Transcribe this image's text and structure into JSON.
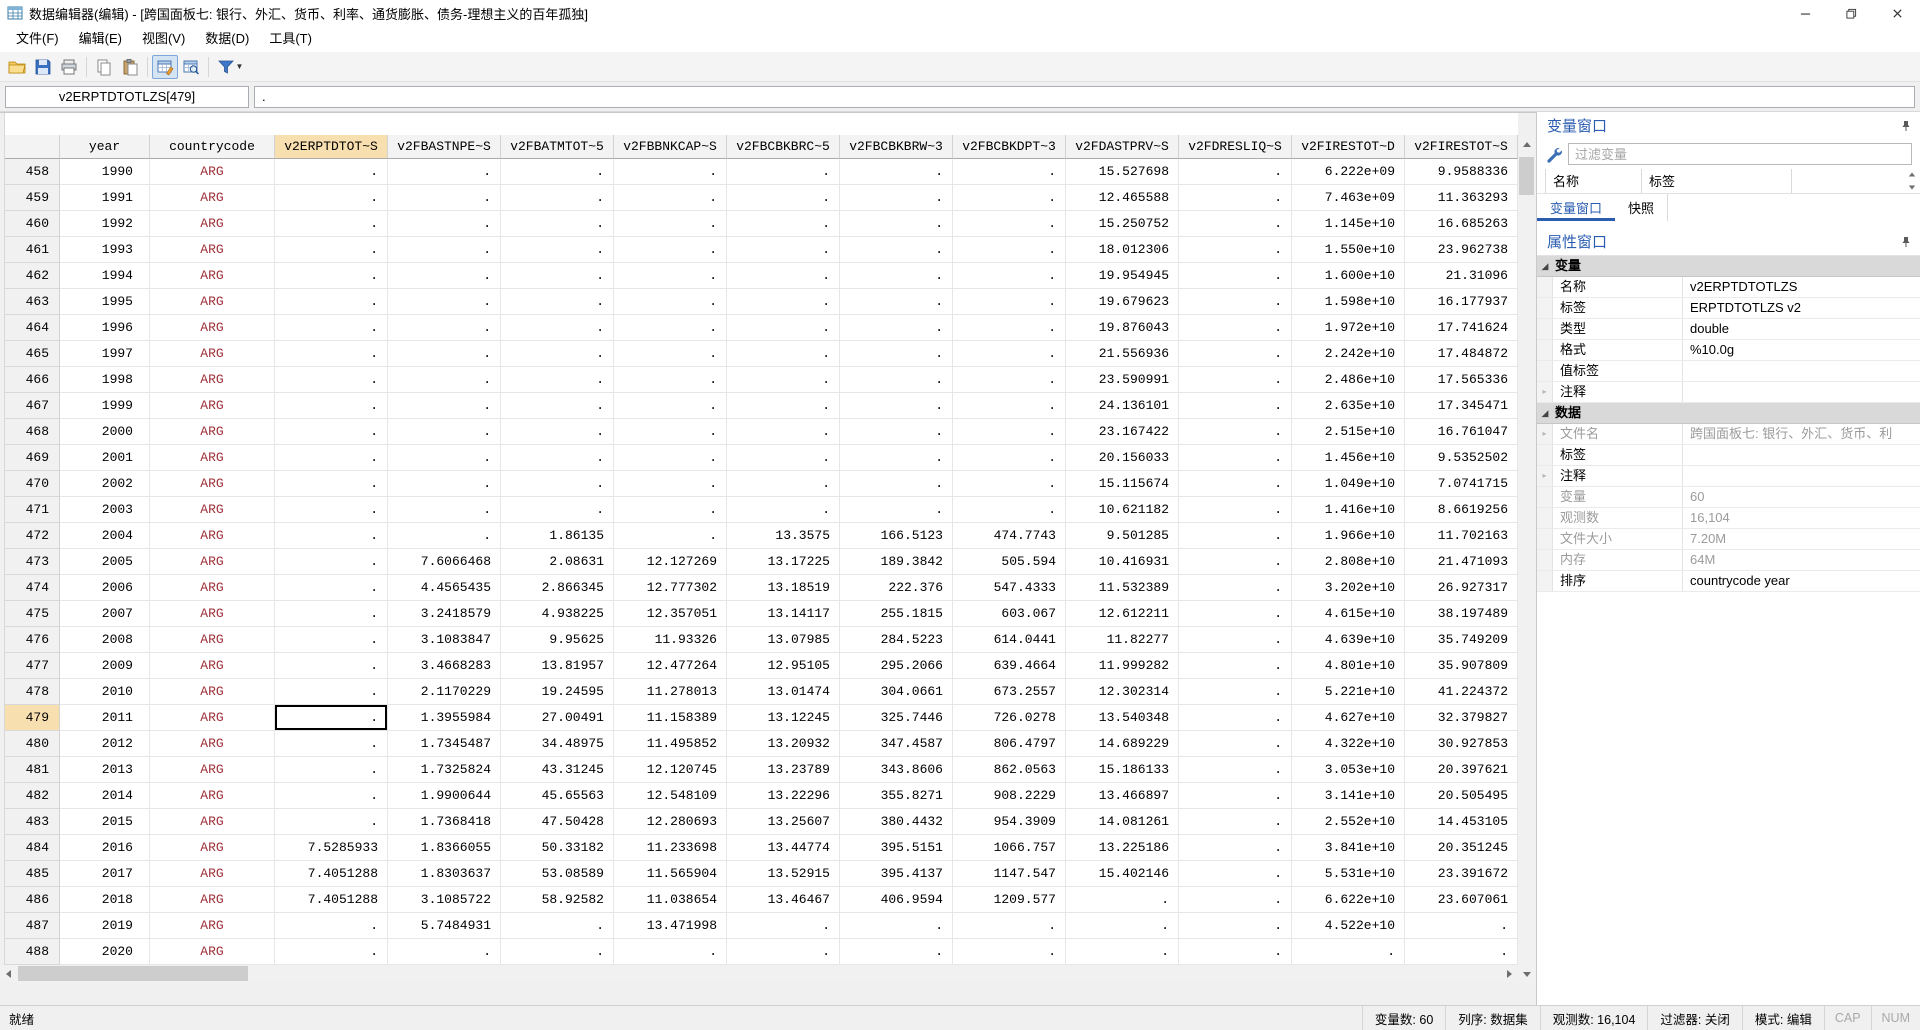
{
  "window": {
    "title": "数据编辑器(编辑) - [跨国面板七: 银行、外汇、货币、利率、通货膨胀、债务-理想主义的百年孤独]"
  },
  "menu": [
    "文件(F)",
    "编辑(E)",
    "视图(V)",
    "数据(D)",
    "工具(T)"
  ],
  "toolbar": {
    "icons": [
      "open-icon",
      "save-icon",
      "print-icon",
      "copy-icon",
      "paste-icon",
      "data-editor-icon",
      "data-browser-icon",
      "filter-icon"
    ]
  },
  "formula_bar": {
    "cell_ref": "v2ERPTDTOTLZS[479]",
    "cell_value": "."
  },
  "table": {
    "columns": [
      "year",
      "countrycode",
      "v2ERPTDTOT~S",
      "v2FBASTNPE~S",
      "v2FBATMTOT~5",
      "v2FBBNKCAP~S",
      "v2FBCBKBRC~5",
      "v2FBCBKBRW~3",
      "v2FBCBKDPT~3",
      "v2FDASTPRV~S",
      "v2FDRESLIQ~S",
      "v2FIRESTOT~D",
      "v2FIRESTOT~S"
    ],
    "selected": {
      "row_num": "479",
      "column": "v2ERPTDTOT~S",
      "col_index": 2
    },
    "rows": [
      {
        "num": "458",
        "cells": [
          "1990",
          "ARG",
          ".",
          ".",
          ".",
          ".",
          ".",
          ".",
          ".",
          "15.527698",
          ".",
          "6.222e+09",
          "9.9588336"
        ]
      },
      {
        "num": "459",
        "cells": [
          "1991",
          "ARG",
          ".",
          ".",
          ".",
          ".",
          ".",
          ".",
          ".",
          "12.465588",
          ".",
          "7.463e+09",
          "11.363293"
        ]
      },
      {
        "num": "460",
        "cells": [
          "1992",
          "ARG",
          ".",
          ".",
          ".",
          ".",
          ".",
          ".",
          ".",
          "15.250752",
          ".",
          "1.145e+10",
          "16.685263"
        ]
      },
      {
        "num": "461",
        "cells": [
          "1993",
          "ARG",
          ".",
          ".",
          ".",
          ".",
          ".",
          ".",
          ".",
          "18.012306",
          ".",
          "1.550e+10",
          "23.962738"
        ]
      },
      {
        "num": "462",
        "cells": [
          "1994",
          "ARG",
          ".",
          ".",
          ".",
          ".",
          ".",
          ".",
          ".",
          "19.954945",
          ".",
          "1.600e+10",
          "21.31096"
        ]
      },
      {
        "num": "463",
        "cells": [
          "1995",
          "ARG",
          ".",
          ".",
          ".",
          ".",
          ".",
          ".",
          ".",
          "19.679623",
          ".",
          "1.598e+10",
          "16.177937"
        ]
      },
      {
        "num": "464",
        "cells": [
          "1996",
          "ARG",
          ".",
          ".",
          ".",
          ".",
          ".",
          ".",
          ".",
          "19.876043",
          ".",
          "1.972e+10",
          "17.741624"
        ]
      },
      {
        "num": "465",
        "cells": [
          "1997",
          "ARG",
          ".",
          ".",
          ".",
          ".",
          ".",
          ".",
          ".",
          "21.556936",
          ".",
          "2.242e+10",
          "17.484872"
        ]
      },
      {
        "num": "466",
        "cells": [
          "1998",
          "ARG",
          ".",
          ".",
          ".",
          ".",
          ".",
          ".",
          ".",
          "23.590991",
          ".",
          "2.486e+10",
          "17.565336"
        ]
      },
      {
        "num": "467",
        "cells": [
          "1999",
          "ARG",
          ".",
          ".",
          ".",
          ".",
          ".",
          ".",
          ".",
          "24.136101",
          ".",
          "2.635e+10",
          "17.345471"
        ]
      },
      {
        "num": "468",
        "cells": [
          "2000",
          "ARG",
          ".",
          ".",
          ".",
          ".",
          ".",
          ".",
          ".",
          "23.167422",
          ".",
          "2.515e+10",
          "16.761047"
        ]
      },
      {
        "num": "469",
        "cells": [
          "2001",
          "ARG",
          ".",
          ".",
          ".",
          ".",
          ".",
          ".",
          ".",
          "20.156033",
          ".",
          "1.456e+10",
          "9.5352502"
        ]
      },
      {
        "num": "470",
        "cells": [
          "2002",
          "ARG",
          ".",
          ".",
          ".",
          ".",
          ".",
          ".",
          ".",
          "15.115674",
          ".",
          "1.049e+10",
          "7.0741715"
        ]
      },
      {
        "num": "471",
        "cells": [
          "2003",
          "ARG",
          ".",
          ".",
          ".",
          ".",
          ".",
          ".",
          ".",
          "10.621182",
          ".",
          "1.416e+10",
          "8.6619256"
        ]
      },
      {
        "num": "472",
        "cells": [
          "2004",
          "ARG",
          ".",
          ".",
          "1.86135",
          ".",
          "13.3575",
          "166.5123",
          "474.7743",
          "9.501285",
          ".",
          "1.966e+10",
          "11.702163"
        ]
      },
      {
        "num": "473",
        "cells": [
          "2005",
          "ARG",
          ".",
          "7.6066468",
          "2.08631",
          "12.127269",
          "13.17225",
          "189.3842",
          "505.594",
          "10.416931",
          ".",
          "2.808e+10",
          "21.471093"
        ]
      },
      {
        "num": "474",
        "cells": [
          "2006",
          "ARG",
          ".",
          "4.4565435",
          "2.866345",
          "12.777302",
          "13.18519",
          "222.376",
          "547.4333",
          "11.532389",
          ".",
          "3.202e+10",
          "26.927317"
        ]
      },
      {
        "num": "475",
        "cells": [
          "2007",
          "ARG",
          ".",
          "3.2418579",
          "4.938225",
          "12.357051",
          "13.14117",
          "255.1815",
          "603.067",
          "12.612211",
          ".",
          "4.615e+10",
          "38.197489"
        ]
      },
      {
        "num": "476",
        "cells": [
          "2008",
          "ARG",
          ".",
          "3.1083847",
          "9.95625",
          "11.93326",
          "13.07985",
          "284.5223",
          "614.0441",
          "11.82277",
          ".",
          "4.639e+10",
          "35.749209"
        ]
      },
      {
        "num": "477",
        "cells": [
          "2009",
          "ARG",
          ".",
          "3.4668283",
          "13.81957",
          "12.477264",
          "12.95105",
          "295.2066",
          "639.4664",
          "11.999282",
          ".",
          "4.801e+10",
          "35.907809"
        ]
      },
      {
        "num": "478",
        "cells": [
          "2010",
          "ARG",
          ".",
          "2.1170229",
          "19.24595",
          "11.278013",
          "13.01474",
          "304.0661",
          "673.2557",
          "12.302314",
          ".",
          "5.221e+10",
          "41.224372"
        ]
      },
      {
        "num": "479",
        "cells": [
          "2011",
          "ARG",
          ".",
          "1.3955984",
          "27.00491",
          "11.158389",
          "13.12245",
          "325.7446",
          "726.0278",
          "13.540348",
          ".",
          "4.627e+10",
          "32.379827"
        ]
      },
      {
        "num": "480",
        "cells": [
          "2012",
          "ARG",
          ".",
          "1.7345487",
          "34.48975",
          "11.495852",
          "13.20932",
          "347.4587",
          "806.4797",
          "14.689229",
          ".",
          "4.322e+10",
          "30.927853"
        ]
      },
      {
        "num": "481",
        "cells": [
          "2013",
          "ARG",
          ".",
          "1.7325824",
          "43.31245",
          "12.120745",
          "13.23789",
          "343.8606",
          "862.0563",
          "15.186133",
          ".",
          "3.053e+10",
          "20.397621"
        ]
      },
      {
        "num": "482",
        "cells": [
          "2014",
          "ARG",
          ".",
          "1.9900644",
          "45.65563",
          "12.548109",
          "13.22296",
          "355.8271",
          "908.2229",
          "13.466897",
          ".",
          "3.141e+10",
          "20.505495"
        ]
      },
      {
        "num": "483",
        "cells": [
          "2015",
          "ARG",
          ".",
          "1.7368418",
          "47.50428",
          "12.280693",
          "13.25607",
          "380.4432",
          "954.3909",
          "14.081261",
          ".",
          "2.552e+10",
          "14.453105"
        ]
      },
      {
        "num": "484",
        "cells": [
          "2016",
          "ARG",
          "7.5285933",
          "1.8366055",
          "50.33182",
          "11.233698",
          "13.44774",
          "395.5151",
          "1066.757",
          "13.225186",
          ".",
          "3.841e+10",
          "20.351245"
        ]
      },
      {
        "num": "485",
        "cells": [
          "2017",
          "ARG",
          "7.4051288",
          "1.8303637",
          "53.08589",
          "11.565904",
          "13.52915",
          "395.4137",
          "1147.547",
          "15.402146",
          ".",
          "5.531e+10",
          "23.391672"
        ]
      },
      {
        "num": "486",
        "cells": [
          "2018",
          "ARG",
          "7.4051288",
          "3.1085722",
          "58.92582",
          "11.038654",
          "13.46467",
          "406.9594",
          "1209.577",
          ".",
          ".",
          "6.622e+10",
          "23.607061"
        ]
      },
      {
        "num": "487",
        "cells": [
          "2019",
          "ARG",
          ".",
          "5.7484931",
          ".",
          "13.471998",
          ".",
          ".",
          ".",
          ".",
          ".",
          "4.522e+10",
          "."
        ]
      },
      {
        "num": "488",
        "cells": [
          "2020",
          "ARG",
          ".",
          ".",
          ".",
          ".",
          ".",
          ".",
          ".",
          ".",
          ".",
          ".",
          "."
        ]
      }
    ]
  },
  "variables_panel": {
    "title": "变量窗口",
    "filter_placeholder": "过滤变量",
    "columns": [
      "名称",
      "标签"
    ],
    "tabs": [
      {
        "label": "变量窗口",
        "active": true
      },
      {
        "label": "快照",
        "active": false
      }
    ]
  },
  "properties_panel": {
    "title": "属性窗口",
    "groups": [
      {
        "label": "变量",
        "rows": [
          {
            "label": "名称",
            "value": "v2ERPTDTOTLZS"
          },
          {
            "label": "标签",
            "value": "ERPTDTOTLZS v2"
          },
          {
            "label": "类型",
            "value": "double"
          },
          {
            "label": "格式",
            "value": "%10.0g"
          },
          {
            "label": "值标签",
            "value": ""
          },
          {
            "label": "注释",
            "value": "",
            "expand": true
          }
        ]
      },
      {
        "label": "数据",
        "rows": [
          {
            "label": "文件名",
            "value": "跨国面板七: 银行、外汇、货币、利",
            "expand": true,
            "label_muted": true,
            "value_muted": true
          },
          {
            "label": "标签",
            "value": ""
          },
          {
            "label": "注释",
            "value": "",
            "expand": true
          },
          {
            "label": "变量",
            "value": "60",
            "label_muted": true,
            "value_muted": true
          },
          {
            "label": "观测数",
            "value": "16,104",
            "label_muted": true,
            "value_muted": true
          },
          {
            "label": "文件大小",
            "value": "7.20M",
            "label_muted": true,
            "value_muted": true
          },
          {
            "label": "内存",
            "value": "64M",
            "label_muted": true,
            "value_muted": true
          },
          {
            "label": "排序",
            "value": "countrycode year"
          }
        ]
      }
    ]
  },
  "status_bar": {
    "left": "就绪",
    "items": [
      {
        "label": "变量数: 60"
      },
      {
        "label": "列序: 数据集"
      },
      {
        "label": "观测数: 16,104"
      },
      {
        "label": "过滤器: 关闭"
      },
      {
        "label": "模式: 编辑"
      },
      {
        "label": "CAP",
        "muted": true
      },
      {
        "label": "NUM",
        "muted": true
      }
    ]
  },
  "colors": {
    "selection_tan": "#f8dfb0",
    "string_red": "#9e3039",
    "panel_blue": "#2a5db0"
  }
}
